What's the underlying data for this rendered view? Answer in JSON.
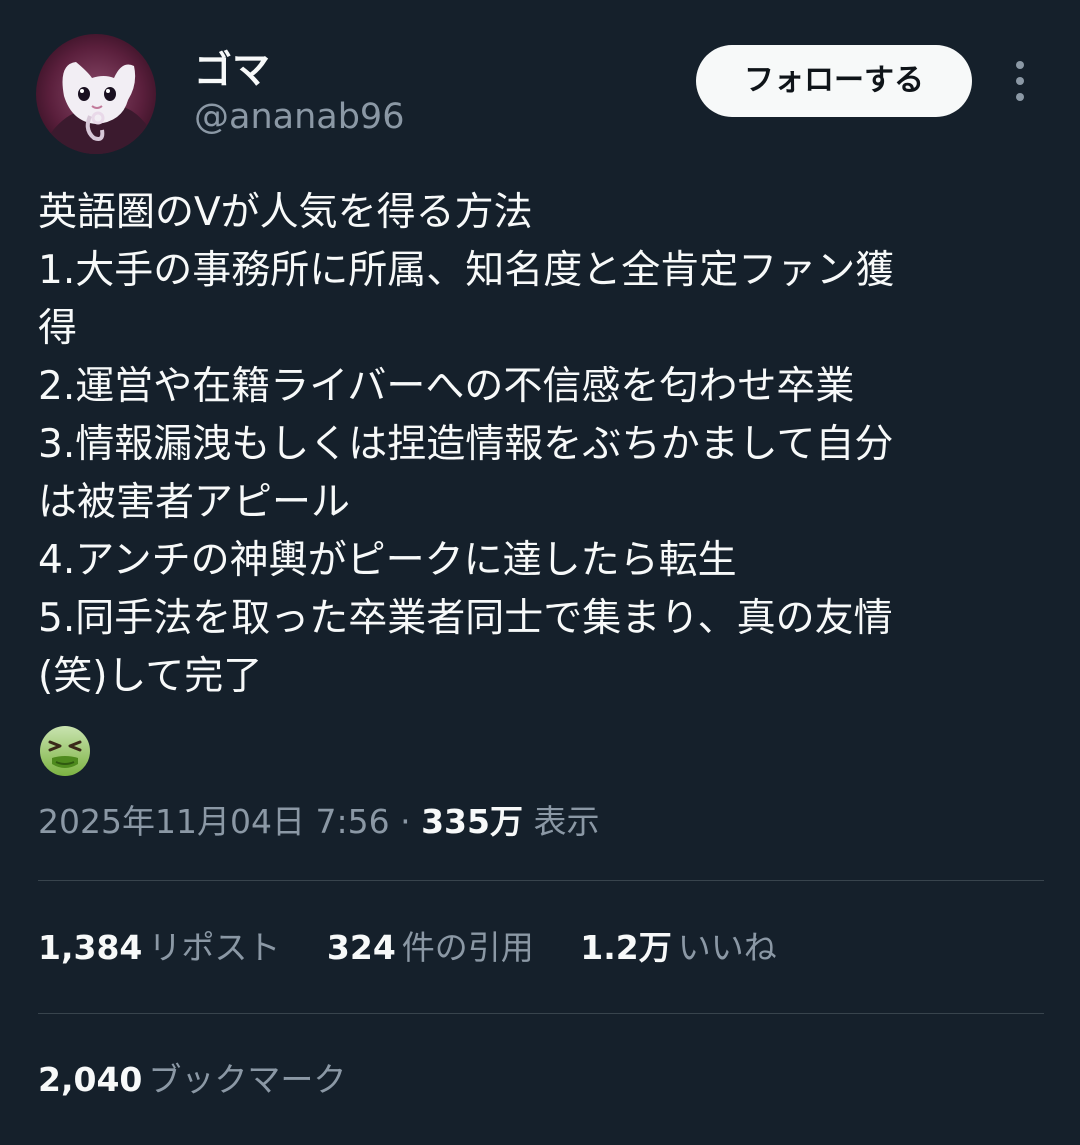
{
  "user": {
    "name": "ゴマ",
    "handle": "@ananab96",
    "avatar_icon": "avatar-image"
  },
  "follow_button": {
    "label": "フォローする"
  },
  "more_icon": "more-vertical-icon",
  "tweet": {
    "lines": [
      "英語圏のVが人気を得る方法",
      "1.大手の事務所に所属、知名度と全肯定ファン獲",
      "得",
      "2.運営や在籍ライバーへの不信感を匂わせ卒業",
      "3.情報漏洩もしくは捏造情報をぶちかまして自分",
      "は被害者アピール",
      "4.アンチの神輿がピークに達したら転生",
      "5.同手法を取った卒業者同士で集まり、真の友情",
      "(笑)して完了"
    ],
    "emoji_icon": "nauseated-face-emoji"
  },
  "meta": {
    "timestamp": "2025年11月04日 7:56",
    "separator": "·",
    "views_count": "335万",
    "views_label": "表示"
  },
  "stats": {
    "reposts": {
      "count": "1,384",
      "label": "リポスト"
    },
    "quotes": {
      "count": "324",
      "label": "件の引用"
    },
    "likes": {
      "count": "1.2万",
      "label": "いいね"
    },
    "bookmarks": {
      "count": "2,040",
      "label": "ブックマーク"
    }
  },
  "colors": {
    "background": "#15202b",
    "primary_text": "#f7f9f9",
    "secondary_text": "#8b98a5",
    "divider": "#38444d",
    "follow_button_bg": "#f7f9f9"
  }
}
